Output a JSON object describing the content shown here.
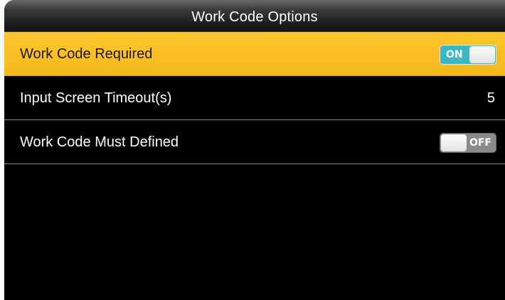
{
  "header": {
    "title": "Work Code Options"
  },
  "options": [
    {
      "label": "Work Code Required",
      "type": "toggle",
      "state_label": "ON",
      "enabled": true,
      "selected": true
    },
    {
      "label": "Input Screen Timeout(s)",
      "type": "value",
      "value": "5",
      "selected": false
    },
    {
      "label": "Work Code Must Defined",
      "type": "toggle",
      "state_label": "OFF",
      "enabled": false,
      "selected": false
    }
  ],
  "colors": {
    "selection_highlight": "#fbbf24",
    "toggle_on": "#3ab8c6",
    "toggle_off": "#8a8a8a",
    "background": "#000000"
  }
}
